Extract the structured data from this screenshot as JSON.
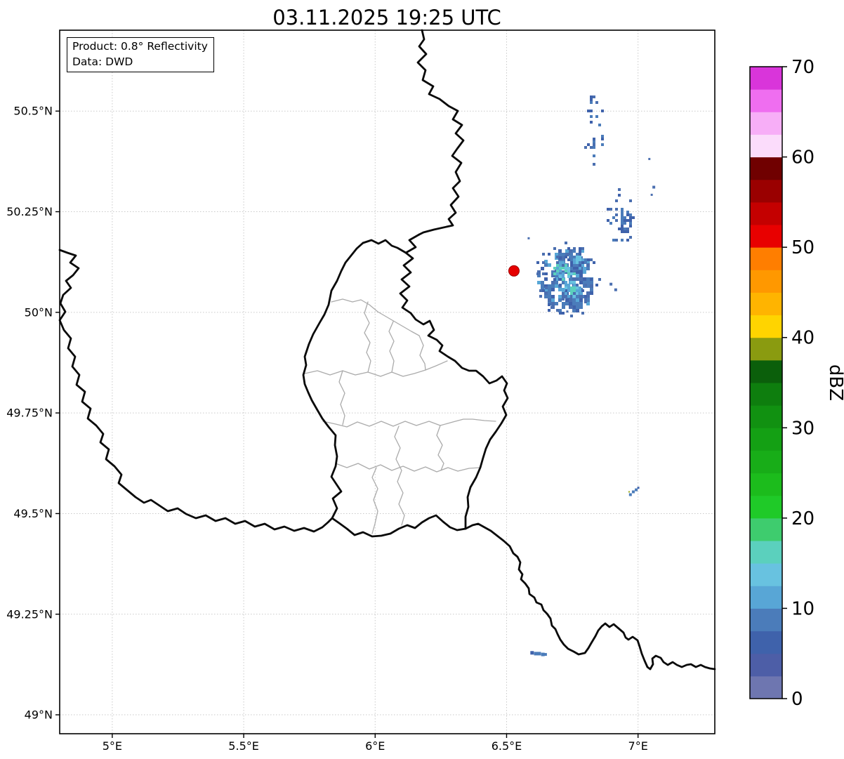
{
  "figure": {
    "title": "03.11.2025 19:25 UTC",
    "info_box": {
      "line1": "Product: 0.8° Reflectivity",
      "line2": "Data: DWD"
    },
    "background_color": "#ffffff"
  },
  "axes": {
    "x": {
      "min": 4.8,
      "max": 7.292,
      "unit": "°E",
      "ticks": [
        {
          "label": "5°E",
          "value": 5.0
        },
        {
          "label": "5.5°E",
          "value": 5.5
        },
        {
          "label": "6°E",
          "value": 6.0
        },
        {
          "label": "6.5°E",
          "value": 6.5
        },
        {
          "label": "7°E",
          "value": 7.0
        }
      ]
    },
    "y": {
      "min": 48.953,
      "max": 50.701,
      "unit": "°N",
      "ticks": [
        {
          "label": "50.5°N",
          "value": 50.5
        },
        {
          "label": "50.25°N",
          "value": 50.25
        },
        {
          "label": "50°N",
          "value": 50.0
        },
        {
          "label": "49.75°N",
          "value": 49.75
        },
        {
          "label": "49.5°N",
          "value": 49.5
        },
        {
          "label": "49.25°N",
          "value": 49.25
        },
        {
          "label": "49°N",
          "value": 49.0
        }
      ]
    },
    "grid_color": "#c9c9c9"
  },
  "colorbar": {
    "label": "dBZ",
    "min": 0,
    "max": 70,
    "step": 2.5,
    "tick_values": [
      0,
      10,
      20,
      30,
      40,
      50,
      60,
      70
    ],
    "colors_bottom_to_top": [
      "#6e76b0",
      "#4d5ea7",
      "#3f62ab",
      "#4b7cba",
      "#58a6d6",
      "#68c2e0",
      "#5bd0bd",
      "#3ecc6e",
      "#1fca28",
      "#1cbc1c",
      "#18ad18",
      "#14a014",
      "#119111",
      "#0e7e0e",
      "#0b5f0b",
      "#8a9b10",
      "#ffd400",
      "#ffb400",
      "#ff9800",
      "#ff7e00",
      "#e80000",
      "#c40000",
      "#9a0000",
      "#700000",
      "#fbdcfb",
      "#f7aef7",
      "#ef6ef0",
      "#d935da"
    ]
  },
  "radar": {
    "site_marker": {
      "lon": 6.528,
      "lat": 50.103,
      "fill": "#e60000",
      "edge": "#a00000",
      "radius_px": 7.5
    },
    "echo_clusters": [
      {
        "name": "main-echo-core",
        "lon": 6.723,
        "lat": 50.082,
        "rx": 0.105,
        "ry": 0.078,
        "n": 300,
        "cell": 5,
        "seed": 7,
        "colors": [
          "#4b7cba",
          "#3f62ab",
          "#4b7cba",
          "#58a6d6",
          "#4b6fb0"
        ]
      },
      {
        "name": "main-echo-fringe",
        "lon": 6.723,
        "lat": 50.082,
        "rx": 0.125,
        "ry": 0.095,
        "n": 90,
        "cell": 4,
        "seed": 8,
        "colors": [
          "#4b6fb0",
          "#3f62ab"
        ]
      },
      {
        "name": "main-echo-light-n",
        "lon": 6.717,
        "lat": 50.108,
        "rx": 0.04,
        "ry": 0.024,
        "n": 55,
        "cell": 4,
        "seed": 11,
        "colors": [
          "#68c2e0",
          "#58a6d6",
          "#5bd0bd"
        ]
      },
      {
        "name": "main-echo-light-s",
        "lon": 6.742,
        "lat": 50.062,
        "rx": 0.036,
        "ry": 0.02,
        "n": 45,
        "cell": 4,
        "seed": 13,
        "colors": [
          "#68c2e0",
          "#58a6d6"
        ]
      },
      {
        "name": "main-echo-aqua",
        "lon": 6.749,
        "lat": 50.057,
        "rx": 0.012,
        "ry": 0.008,
        "n": 10,
        "cell": 4,
        "seed": 14,
        "colors": [
          "#5bd0bd"
        ]
      },
      {
        "name": "ne-lobe",
        "lon": 6.768,
        "lat": 50.133,
        "rx": 0.032,
        "ry": 0.026,
        "n": 50,
        "cell": 4,
        "seed": 17,
        "colors": [
          "#4b7cba",
          "#3f62ab",
          "#58a6d6"
        ]
      },
      {
        "name": "ne-lobe-light",
        "lon": 6.77,
        "lat": 50.133,
        "rx": 0.013,
        "ry": 0.009,
        "n": 10,
        "cell": 4,
        "seed": 19,
        "colors": [
          "#68c2e0"
        ]
      },
      {
        "name": "north-speck-line",
        "lon": 6.83,
        "lat": 50.452,
        "rx": 0.034,
        "ry": 0.098,
        "n": 34,
        "cell": 4,
        "seed": 23,
        "colors": [
          "#4b6fb0",
          "#3f62ab",
          "#4b7cba"
        ]
      },
      {
        "name": "northeast-cluster",
        "lon": 6.929,
        "lat": 50.238,
        "rx": 0.052,
        "ry": 0.07,
        "n": 38,
        "cell": 4,
        "seed": 29,
        "colors": [
          "#4b6fb0",
          "#3f62ab",
          "#4b7cba"
        ]
      },
      {
        "name": "northeast-core",
        "lon": 6.945,
        "lat": 50.228,
        "rx": 0.022,
        "ry": 0.028,
        "n": 30,
        "cell": 4,
        "seed": 31,
        "colors": [
          "#4b7cba",
          "#3f62ab"
        ]
      }
    ],
    "echo_pixels": [
      {
        "lon": 6.584,
        "lat": 50.184,
        "cell": 3,
        "color": "#4b6fb0"
      },
      {
        "lon": 7.043,
        "lat": 50.381,
        "cell": 3,
        "color": "#4b6fb0"
      },
      {
        "lon": 7.06,
        "lat": 50.311,
        "cell": 4,
        "color": "#4b6fb0"
      },
      {
        "lon": 7.052,
        "lat": 50.292,
        "cell": 3,
        "color": "#4b6fb0"
      },
      {
        "lon": 6.897,
        "lat": 50.07,
        "cell": 4,
        "color": "#4b6fb0"
      },
      {
        "lon": 6.915,
        "lat": 50.056,
        "cell": 4,
        "color": "#4b6fb0"
      },
      {
        "lon": 6.731,
        "lat": 50.002,
        "cell": 3,
        "color": "#4b6fb0"
      },
      {
        "lon": 6.971,
        "lat": 49.547,
        "cell": 4,
        "color": "#4b7cba"
      },
      {
        "lon": 6.982,
        "lat": 49.554,
        "cell": 4,
        "color": "#4b7cba"
      },
      {
        "lon": 6.993,
        "lat": 49.559,
        "cell": 4,
        "color": "#4b7cba"
      },
      {
        "lon": 7.001,
        "lat": 49.564,
        "cell": 3,
        "color": "#3f62ab"
      },
      {
        "lon": 6.966,
        "lat": 49.554,
        "cell": 2,
        "color": "#9aa818"
      },
      {
        "lon": 6.597,
        "lat": 49.154,
        "cell": 5,
        "color": "#3f62ab"
      },
      {
        "lon": 6.611,
        "lat": 49.152,
        "cell": 5,
        "color": "#4b7cba"
      },
      {
        "lon": 6.624,
        "lat": 49.152,
        "cell": 5,
        "color": "#4b7cba"
      },
      {
        "lon": 6.638,
        "lat": 49.15,
        "cell": 5,
        "color": "#4b7cba"
      },
      {
        "lon": 6.648,
        "lat": 49.15,
        "cell": 4,
        "color": "#4b7cba"
      }
    ]
  }
}
